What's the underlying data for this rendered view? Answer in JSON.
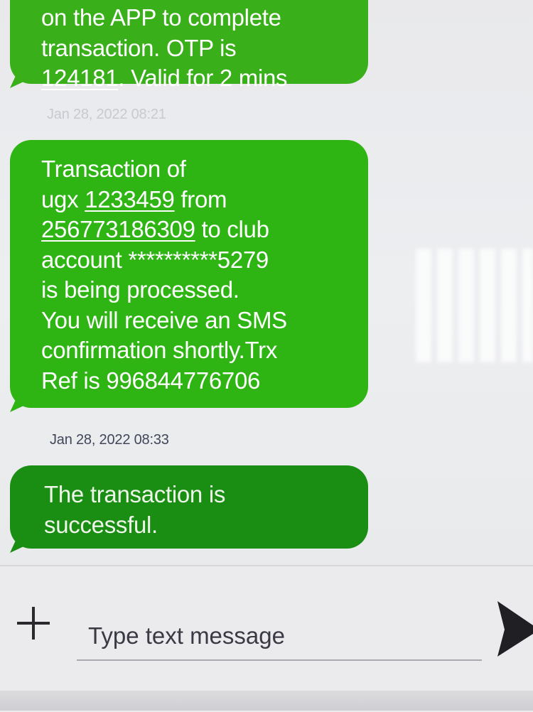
{
  "messages": [
    {
      "lines": [
        [
          "on the APP to complete"
        ],
        [
          "transaction. OTP is"
        ],
        [
          {
            "text": "124181",
            "link": true
          },
          ". Valid for 2 mins"
        ]
      ]
    },
    {
      "timestamp": "Jan 28, 2022  08:21",
      "lines": [
        [
          "Transaction of"
        ],
        [
          "ugx ",
          {
            "text": "1233459",
            "link": true
          },
          " from"
        ],
        [
          {
            "text": "256773186309",
            "link": true
          },
          " to club"
        ],
        [
          "account **********5279"
        ],
        [
          "is being processed."
        ],
        [
          "You will receive an SMS"
        ],
        [
          "confirmation shortly.Trx"
        ],
        [
          "Ref is 996844776706"
        ]
      ]
    },
    {
      "timestamp": "Jan 28, 2022  08:33",
      "lines": [
        [
          "The transaction is"
        ],
        [
          "successful."
        ]
      ]
    }
  ],
  "composer": {
    "placeholder": "Type text message",
    "add_icon": "plus-icon",
    "send_icon": "send-icon"
  },
  "colors": {
    "bubble_green": "#2fb513",
    "bubble_dark_green": "#1a8d13",
    "background": "#eaebed"
  }
}
